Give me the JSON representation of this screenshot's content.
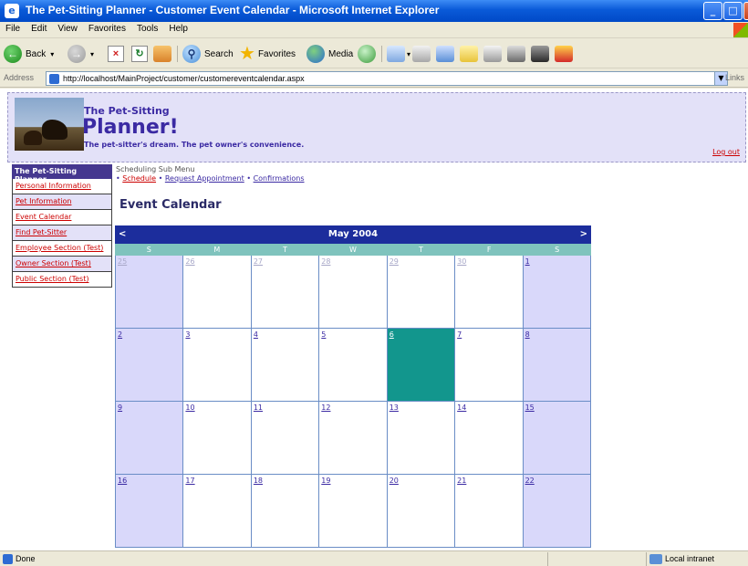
{
  "window": {
    "title": "The Pet-Sitting Planner - Customer Event Calendar - Microsoft Internet Explorer"
  },
  "menu": [
    "File",
    "Edit",
    "View",
    "Favorites",
    "Tools",
    "Help"
  ],
  "toolbar": {
    "back_label": "Back",
    "search_label": "Search",
    "favorites_label": "Favorites",
    "media_label": "Media"
  },
  "address": {
    "label": "Address",
    "url": "http://localhost/MainProject/customer/customereventcalendar.aspx",
    "links_label": "Links"
  },
  "header": {
    "brand_small": "The Pet-Sitting",
    "brand_big": "Planner!",
    "tagline": "The pet-sitter's dream. The pet owner's convenience.",
    "logout": "Log out"
  },
  "nav": {
    "heading": "The Pet-Sitting Planner",
    "items": [
      "Personal Information",
      "Pet Information",
      "Event Calendar",
      "Find Pet-Sitter",
      "Employee Section (Test)",
      "Owner Section (Test)",
      "Public Section (Test)"
    ]
  },
  "submenu": {
    "title": "Scheduling Sub Menu",
    "links": [
      "Schedule",
      "Request Appointment",
      "Confirmations"
    ],
    "separator": "•"
  },
  "page_title": "Event Calendar",
  "calendar": {
    "month": "May 2004",
    "prev": "<",
    "next": ">",
    "days_of_week": [
      "S",
      "M",
      "T",
      "W",
      "T",
      "F",
      "S"
    ],
    "weeks": [
      [
        "25",
        "26",
        "27",
        "28",
        "29",
        "30",
        "1"
      ],
      [
        "2",
        "3",
        "4",
        "5",
        "6",
        "7",
        "8"
      ],
      [
        "9",
        "10",
        "11",
        "12",
        "13",
        "14",
        "15"
      ],
      [
        "16",
        "17",
        "18",
        "19",
        "20",
        "21",
        "22"
      ]
    ],
    "other_month_days": [
      "25",
      "26",
      "27",
      "28",
      "29",
      "30"
    ],
    "selected_day": "6",
    "colors": {
      "header": "#1c2d9c",
      "weekend": "#d9d8fa",
      "selected": "#12968d",
      "dow_bar": "#7fc3bd"
    }
  },
  "status": {
    "text": "Done",
    "zone": "Local intranet"
  }
}
